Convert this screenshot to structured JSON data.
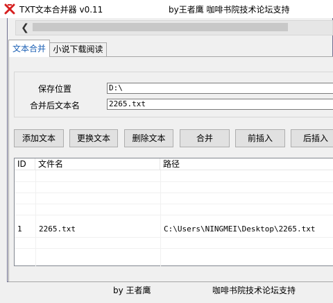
{
  "window": {
    "title": "TXT文本合并器 v0.11",
    "author_title": "by王者鹰 咖啡书院技术论坛支持",
    "icon": "red-x-logo-icon"
  },
  "tabs": [
    {
      "label": "文本合并",
      "active": true
    },
    {
      "label": "小说下载阅读",
      "active": false
    }
  ],
  "form": {
    "save_label": "保存位置",
    "save_value": "D:\\",
    "name_label": "合并后文本名",
    "name_value": "2265.txt"
  },
  "buttons": {
    "add": "添加文本",
    "replace": "更换文本",
    "delete": "删除文本",
    "merge": "合并",
    "insert_before": "前插入",
    "insert_after": "后插入"
  },
  "list": {
    "columns": [
      "ID",
      "文件名",
      "路径"
    ],
    "rows": [
      {
        "id": "1",
        "name": "2265.txt",
        "path": "C:\\Users\\NINGMEI\\Desktop\\2265.txt"
      }
    ]
  },
  "footer": {
    "author": "by 王者鹰",
    "forum": "咖啡书院技术论坛支持"
  },
  "colors": {
    "accent_tab": "#1a5fb4",
    "icon_red": "#d61f1f"
  }
}
